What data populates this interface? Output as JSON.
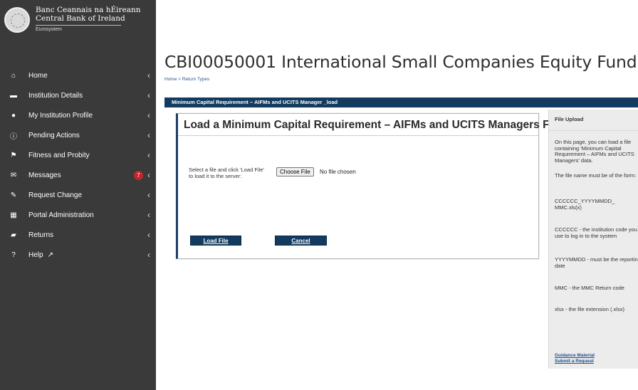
{
  "brand": {
    "irish": "Banc Ceannais na hÉireann",
    "english": "Central Bank of Ireland",
    "tagline": "Eurosystem"
  },
  "sidebar": {
    "items": [
      {
        "label": "Home",
        "icon": "home-icon",
        "glyph": "⌂"
      },
      {
        "label": "Institution Details",
        "icon": "building-icon",
        "glyph": "▬"
      },
      {
        "label": "My Institution Profile",
        "icon": "user-icon",
        "glyph": "●"
      },
      {
        "label": "Pending Actions",
        "icon": "info-icon",
        "glyph": "ⓘ"
      },
      {
        "label": "Fitness and Probity",
        "icon": "flag-icon",
        "glyph": "⚑"
      },
      {
        "label": "Messages",
        "icon": "envelope-icon",
        "glyph": "✉",
        "badge": "7"
      },
      {
        "label": "Request Change",
        "icon": "edit-icon",
        "glyph": "✎"
      },
      {
        "label": "Portal Administration",
        "icon": "grid-icon",
        "glyph": "▦"
      },
      {
        "label": "Returns",
        "icon": "folder-icon",
        "glyph": "▰"
      },
      {
        "label": "Help",
        "icon": "question-icon",
        "glyph": "?"
      }
    ],
    "chevron": "‹"
  },
  "page": {
    "title": "CBI00050001 International Small Companies Equity Fund",
    "breadcrumb": "Home > Return Types"
  },
  "panel": {
    "header": "Minimum Capital Requirement – AIFMs and UCITS Manager _load"
  },
  "form": {
    "title": "Load a Minimum Capital Requirement – AIFMs and UCITS Managers File",
    "prompt": "Select a file and click 'Load File' to load it to the server:",
    "choose_label": "Choose File",
    "no_file": "No file chosen",
    "load_label": "Load File",
    "cancel_label": "Cancel"
  },
  "side": {
    "title": "File Upload",
    "p1": "On this page, you can load a file containing 'Minimum Capital Requirement – AIFMs and UCITS Managers' data.",
    "p2": "The file name must be of the form:",
    "p3": "CCCCCC_YYYYMMDD_\nMMC.xls(x)",
    "p4": "CCCCCC - the institution code you use to log in to the system",
    "p5": "YYYYMMDD - must be the reporting date",
    "p6": "MMC - the MMC Return code",
    "p7": "xlsx - the file extension (.xlsx)",
    "link1": "Guidance Material",
    "link2": "Submit a Request"
  },
  "colors": {
    "sidebar_bg": "#3a3a3a",
    "header_navy": "#123b5f",
    "badge_red": "#c0282d",
    "link_blue": "#1f4e8a"
  }
}
